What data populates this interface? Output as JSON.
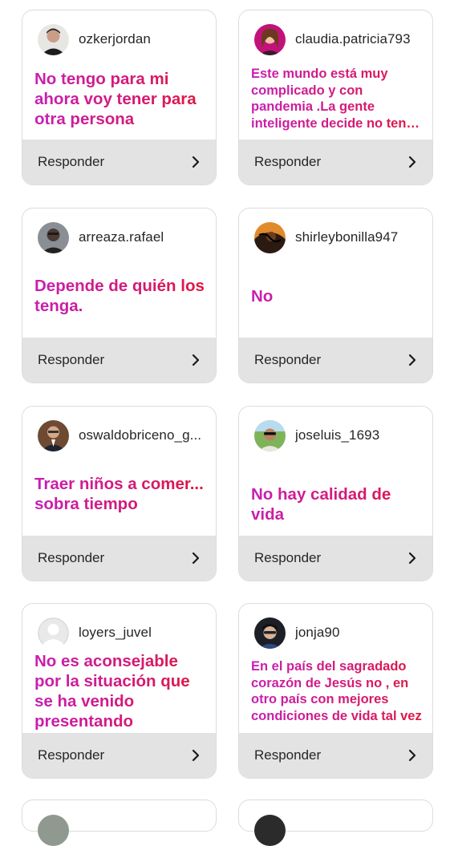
{
  "reply_label": "Responder",
  "cards": [
    {
      "username": "ozkerjordan",
      "answer": "No tengo para mi ahora voy  tener para otra persona"
    },
    {
      "username": "claudia.patricia793",
      "answer": "Este mundo está muy complicado y con pandemia .La gente inteligente decide no tener hijos"
    },
    {
      "username": "arreaza.rafael",
      "answer": "Depende de quién los tenga."
    },
    {
      "username": "shirleybonilla947",
      "answer": "No"
    },
    {
      "username": "oswaldobriceno_g...",
      "answer": "Traer niños a comer... sobra tiempo"
    },
    {
      "username": "joseluis_1693",
      "answer": "No hay calidad de vida"
    },
    {
      "username": "loyers_juvel",
      "answer": "No es aconsejable por la situación que se ha venido presentando actualmente"
    },
    {
      "username": "jonja90",
      "answer": "En el país del sagradado corazón de Jesús no , en otro país con mejores condiciones de vida tal vez"
    }
  ],
  "colors": {
    "gradient_start": "#c81fb4",
    "gradient_end": "#e0163c",
    "reply_bar": "#e3e3e3",
    "card_border": "#dcdcdc"
  },
  "icons": {
    "reply": "chevron-right-icon",
    "avatar": "avatar"
  }
}
